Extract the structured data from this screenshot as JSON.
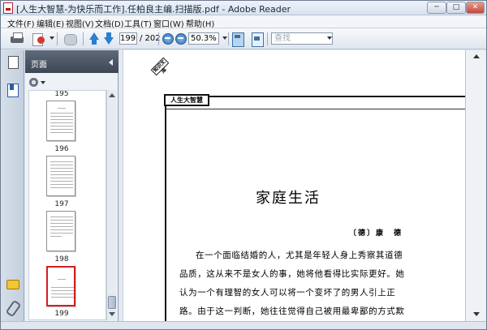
{
  "window": {
    "title": "[人生大智慧-为快乐而工作].任柏良主编.扫描版.pdf - Adobe Reader",
    "min_label": "─",
    "max_label": "□",
    "close_label": "✕"
  },
  "menu": {
    "items": [
      {
        "label": "文件(F)"
      },
      {
        "label": "编辑(E)"
      },
      {
        "label": "视图(V)"
      },
      {
        "label": "文档(D)"
      },
      {
        "label": "工具(T)"
      },
      {
        "label": "窗口(W)"
      },
      {
        "label": "帮助(H)"
      }
    ]
  },
  "toolbar": {
    "current_page": "199",
    "total_pages": "/ 202",
    "zoom": "50.3%",
    "search_placeholder": "查找"
  },
  "panel": {
    "title": "页面",
    "thumbnails": [
      {
        "label": "195"
      },
      {
        "label": "196"
      },
      {
        "label": "197"
      },
      {
        "label": "198"
      },
      {
        "label": "199"
      }
    ]
  },
  "document": {
    "stamp": "知识文库",
    "header": "人生大智慧",
    "chapter_title": "家庭生活",
    "author": "〔德〕康　德",
    "paragraph_lines": [
      "在一个面临结婚的人，尤其是年轻人身上秀察其道德",
      "品质，这从来不是女人的事，她将他看得比实际更好。她",
      "认为一个有理智的女人可以将一个变坏了的男人引上正",
      "路。由于这一判断，她往往觉得自己被用最卑鄙的方式欺"
    ]
  }
}
